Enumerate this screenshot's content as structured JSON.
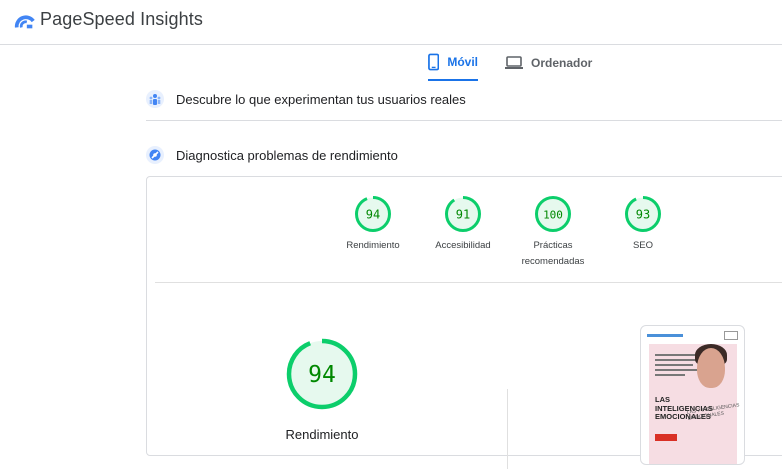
{
  "app": {
    "title": "PageSpeed Insights",
    "logo_icon": "pagespeed-logo-icon"
  },
  "tabs": [
    {
      "label": "Móvil",
      "icon": "mobile-phone-icon",
      "active": true
    },
    {
      "label": "Ordenador",
      "icon": "laptop-icon",
      "active": false
    }
  ],
  "sections": {
    "field": {
      "label": "Descubre lo que experimentan tus usuarios reales",
      "icon": "users-data-icon"
    },
    "lab": {
      "label": "Diagnostica problemas de rendimiento",
      "icon": "lighthouse-icon"
    }
  },
  "scores": [
    {
      "value": "94",
      "label": "Rendimiento"
    },
    {
      "value": "91",
      "label": "Accesibilidad"
    },
    {
      "value": "100",
      "label": "Prácticas\nrecomendadas"
    },
    {
      "value": "93",
      "label": "SEO"
    }
  ],
  "main_score": {
    "value": "94",
    "label": "Rendimiento"
  },
  "thumbnail": {
    "title": "LAS\nINTELIGENCIAS\nEMOCIONALES",
    "subtitle": "LAS 7 INTELIGENCIAS\nEMOCIONALES"
  },
  "colors": {
    "accent": "#1a73e8",
    "pass": "#0cce6b",
    "pass_text": "#008800",
    "pass_fill": "#e6f9ee"
  }
}
